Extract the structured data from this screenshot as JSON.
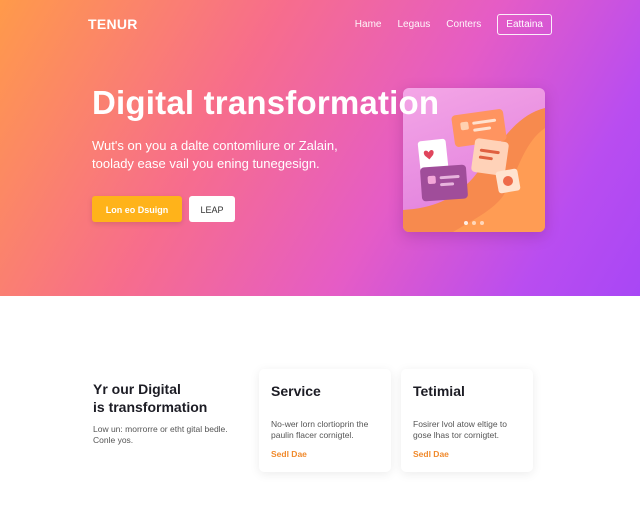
{
  "brand": {
    "logo": "TENUR"
  },
  "nav": {
    "links": [
      "Hame",
      "Legaus",
      "Conters"
    ],
    "button": "Eattaina"
  },
  "hero": {
    "title": "Digital transformation",
    "subtitle": "Wut's on you a dalte contomliure or Zalain, toolady ease vail you ening tunegesign.",
    "primary_cta": "Lon eo Dsuign",
    "secondary_cta": "LEAP",
    "carousel_dots": 3
  },
  "section": {
    "title_line1": "Yr our Digital",
    "title_line2": "is transformation",
    "description": "Low un: morrorre or etht gital bedle. Conle yos."
  },
  "cards": [
    {
      "title": "Service",
      "description": "No-wer lorn clortioprin the paulin flacer cornigtel.",
      "link": "Sedl Dae"
    },
    {
      "title": "Tetimial",
      "description": "Fosirer lvol atow eltige to gose lhas tor cornigtet.",
      "link": "Sedl Dae"
    }
  ],
  "colors": {
    "gradient_start": "#ff9a4a",
    "gradient_end": "#a847f5",
    "cta_primary": "#ffb31a",
    "card_link": "#f08a2c"
  }
}
